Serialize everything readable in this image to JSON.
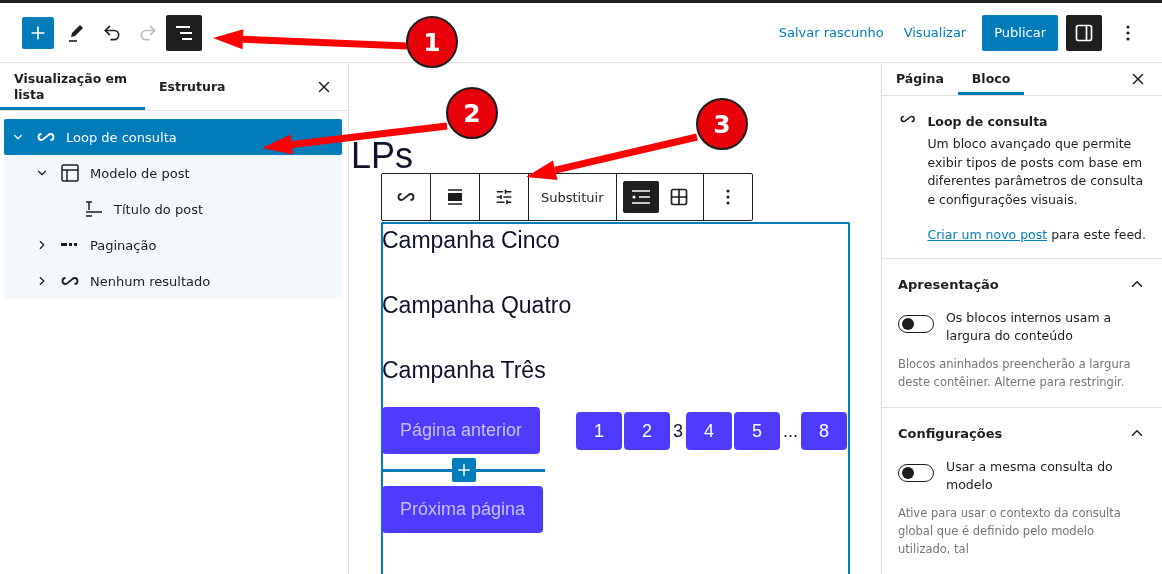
{
  "top_bar": {
    "tools": [
      {
        "kind": "inserter",
        "selected": false,
        "disabled": false
      },
      {
        "kind": "tools",
        "selected": false,
        "disabled": false
      },
      {
        "kind": "undo",
        "selected": false,
        "disabled": false
      },
      {
        "kind": "redo",
        "selected": false,
        "disabled": true
      },
      {
        "kind": "list-view",
        "selected": true,
        "disabled": false
      }
    ],
    "save_draft": "Salvar rascunho",
    "preview": "Visualizar",
    "publish": "Publicar",
    "settings_toggle": {
      "selected": true
    }
  },
  "list_panel": {
    "tabs": [
      {
        "label": "Visualização em lista",
        "selected": true
      },
      {
        "label": "Estrutura",
        "selected": false
      }
    ],
    "tree": [
      {
        "label": "Loop de consulta",
        "kind": "loop",
        "expanded": true,
        "selected": true,
        "children": [
          {
            "label": "Modelo de post",
            "kind": "template",
            "expanded": true,
            "selected": false,
            "children": [
              {
                "label": "Título do post",
                "kind": "title",
                "selected": false
              }
            ]
          },
          {
            "label": "Paginação",
            "kind": "pagination",
            "expanded": false,
            "selected": false
          },
          {
            "label": "Nenhum resultado",
            "kind": "loop",
            "expanded": false,
            "selected": false
          }
        ]
      }
    ]
  },
  "canvas": {
    "page_title": "LPs",
    "block_toolbar": [
      {
        "kind": "loop",
        "selected": false
      },
      {
        "kind": "align",
        "selected": false
      },
      {
        "kind": "settings",
        "selected": false
      },
      {
        "kind": "text",
        "label": "Substituir",
        "selected": false
      },
      {
        "kind": "list",
        "selected": true
      },
      {
        "kind": "grid",
        "selected": false
      },
      {
        "kind": "more",
        "selected": false
      }
    ],
    "posts": [
      "Campanha Cinco",
      "Campanha Quatro",
      "Campanha Três"
    ],
    "previous": "Página anterior",
    "next": "Próxima página",
    "pages": [
      {
        "label": "1",
        "kind": "link"
      },
      {
        "label": "2",
        "kind": "link"
      },
      {
        "label": "3",
        "kind": "current"
      },
      {
        "label": "4",
        "kind": "link"
      },
      {
        "label": "5",
        "kind": "link"
      },
      {
        "label": "...",
        "kind": "dots"
      },
      {
        "label": "8",
        "kind": "link"
      }
    ]
  },
  "settings_panel": {
    "tabs": [
      {
        "label": "Página",
        "selected": false
      },
      {
        "label": "Bloco",
        "selected": true
      }
    ],
    "block": {
      "name": "Loop de consulta",
      "description": "Um bloco avançado que permite exibir tipos de posts com base em diferentes parâmetros de consulta e configurações visuais.",
      "link": "Criar um novo post",
      "link_suffix": " para este feed."
    },
    "sections": [
      {
        "title": "Apresentação",
        "expanded": true,
        "toggle_label": "Os blocos internos usam a largura do conteúdo",
        "on": false,
        "help": "Blocos aninhados preencherão a largura deste contêiner. Alterne para restringir."
      },
      {
        "title": "Configurações",
        "expanded": true,
        "toggle_label": "Usar a mesma consulta do modelo",
        "on": false,
        "help": "Ative para usar o contexto da consulta global que é definido pelo modelo utilizado, tal"
      }
    ]
  },
  "annotations": [
    "1",
    "2",
    "3"
  ]
}
